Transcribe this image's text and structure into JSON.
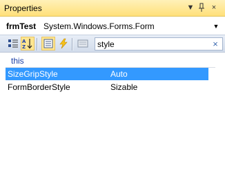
{
  "window": {
    "title": "Properties",
    "dropdown_glyph": "▼",
    "pin_glyph": "📌",
    "close_glyph": "×"
  },
  "object_selector": {
    "name": "frmTest",
    "type": "System.Windows.Forms.Form",
    "arrow_glyph": "▼"
  },
  "toolbar": {
    "buttons": [
      {
        "name": "categorized",
        "icon": "categorized-icon",
        "active": false
      },
      {
        "name": "alphabetical",
        "icon": "alphabetical-icon",
        "active": true
      },
      {
        "name": "properties",
        "icon": "properties-icon",
        "active": true
      },
      {
        "name": "events",
        "icon": "events-icon",
        "active": false
      },
      {
        "name": "property-pages",
        "icon": "property-pages-icon",
        "active": false
      }
    ],
    "search": {
      "value": "style",
      "clear_glyph": "×"
    }
  },
  "grid": {
    "category": "this",
    "rows": [
      {
        "name": "SizeGripStyle",
        "value": "Auto",
        "selected": true
      },
      {
        "name": "FormBorderStyle",
        "value": "Sizable",
        "selected": false
      }
    ]
  },
  "colors": {
    "title_bar": "#ffe07a",
    "selection": "#3399ff",
    "category_text": "#1b3fa5",
    "active_tool": "#ffe690"
  }
}
